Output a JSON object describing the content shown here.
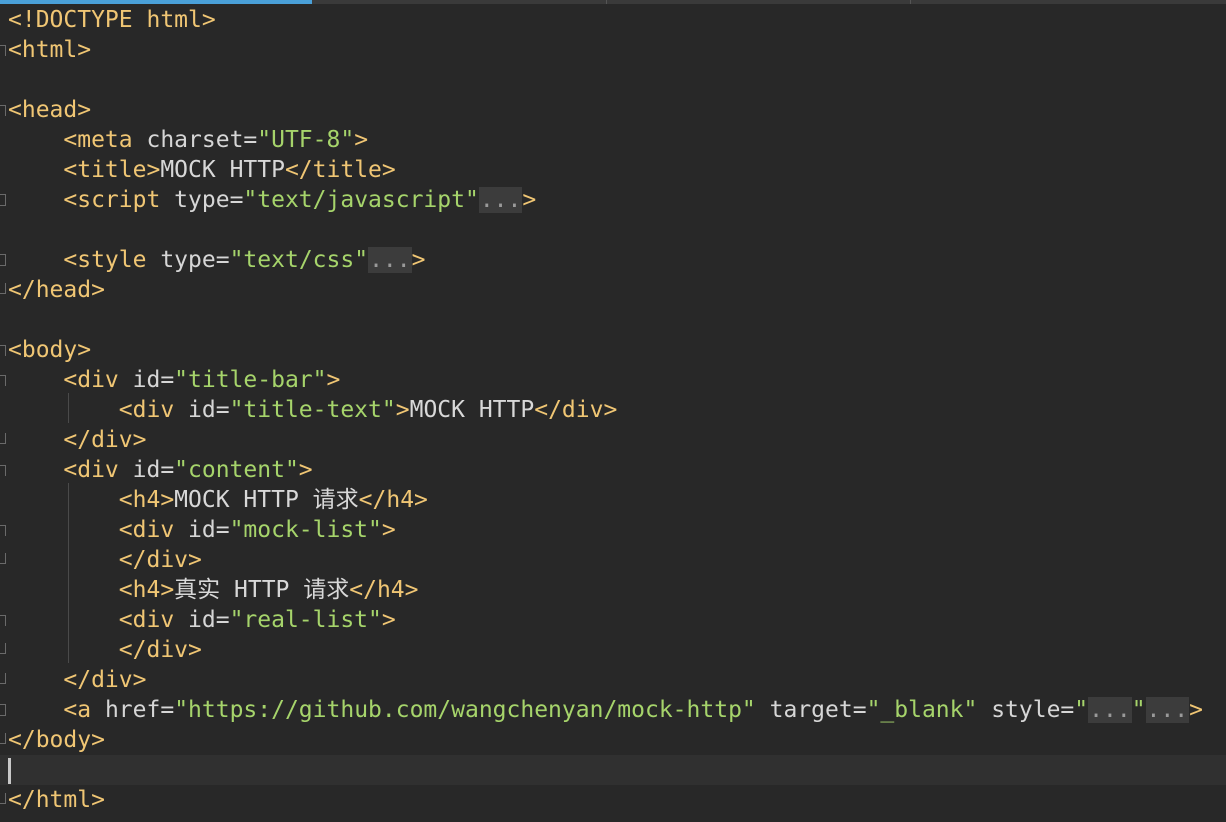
{
  "editor": {
    "lines": [
      {
        "l1": "<!DOCTYPE",
        "l2": " html>"
      },
      {
        "l1": "<html>"
      },
      {},
      {
        "l1": "<head>"
      },
      {
        "ind": "    ",
        "t1": "<meta",
        "a1": " charset=",
        "s1": "\"UTF-8\"",
        "t2": ">"
      },
      {
        "ind": "    ",
        "t1": "<title>",
        "x1": "MOCK HTTP",
        "t2": "</title>"
      },
      {
        "ind": "    ",
        "t1": "<script",
        "a1": " type=",
        "s1": "\"text/javascript\"",
        "f1": "...",
        "t2": ">"
      },
      {},
      {
        "ind": "    ",
        "t1": "<style",
        "a1": " type=",
        "s1": "\"text/css\"",
        "f1": "...",
        "t2": ">"
      },
      {
        "l1": "</head>"
      },
      {},
      {
        "l1": "<body>"
      },
      {
        "ind": "    ",
        "t1": "<div",
        "a1": " id=",
        "s1": "\"title-bar\"",
        "t2": ">"
      },
      {
        "ind": "        ",
        "t1": "<div",
        "a1": " id=",
        "s1": "\"title-text\"",
        "t2": ">",
        "x1": "MOCK HTTP",
        "t3": "</div>"
      },
      {
        "ind": "    ",
        "t1": "</div>"
      },
      {
        "ind": "    ",
        "t1": "<div",
        "a1": " id=",
        "s1": "\"content\"",
        "t2": ">"
      },
      {
        "ind": "        ",
        "t1": "<h4>",
        "x1": "MOCK HTTP 请求",
        "t2": "</h4>"
      },
      {
        "ind": "        ",
        "t1": "<div",
        "a1": " id=",
        "s1": "\"mock-list\"",
        "t2": ">"
      },
      {
        "ind": "        ",
        "t1": "</div>"
      },
      {
        "ind": "        ",
        "t1": "<h4>",
        "x1": "真实 HTTP 请求",
        "t2": "</h4>"
      },
      {
        "ind": "        ",
        "t1": "<div",
        "a1": " id=",
        "s1": "\"real-list\"",
        "t2": ">"
      },
      {
        "ind": "        ",
        "t1": "</div>"
      },
      {
        "ind": "    ",
        "t1": "</div>"
      },
      {
        "ind": "    ",
        "t1": "<a",
        "a1": " href=",
        "s1": "\"https://github.com/wangchenyan/mock-http\"",
        "a2": " target=",
        "s2": "\"_blank\"",
        "a3": " style=",
        "s3": "\"",
        "f1": "...",
        "s4": "\"",
        "f2": "...",
        "t2": ">"
      },
      {
        "l1": "</body>"
      },
      {},
      {
        "l1": "</html>"
      }
    ]
  }
}
